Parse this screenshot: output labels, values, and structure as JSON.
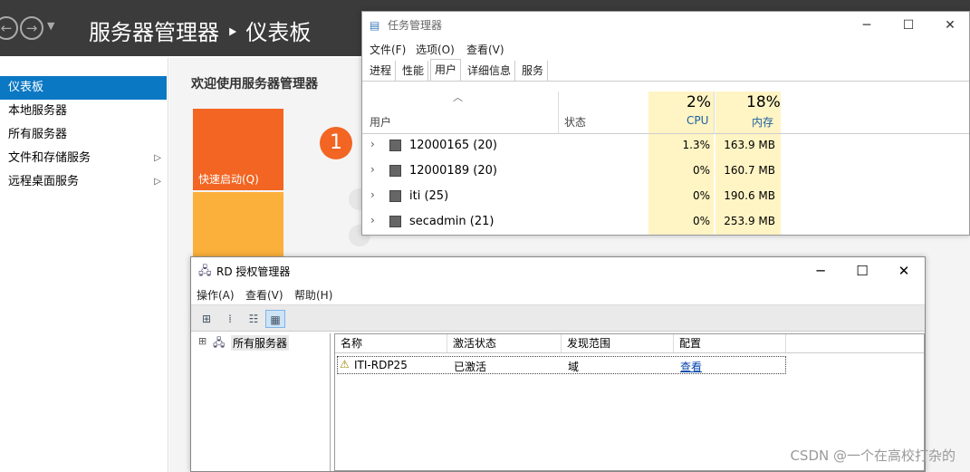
{
  "server_manager": {
    "breadcrumb_title": "服务器管理器 ‣ 仪表板",
    "sidebar": [
      "仪表板",
      "本地服务器",
      "所有服务器",
      "文件和存储服务",
      "远程桌面服务"
    ],
    "welcome": "欢迎使用服务器管理器",
    "quick_start": "快速启动(Q)",
    "step_badge": "1"
  },
  "task_manager": {
    "title": "任务管理器",
    "menu": [
      "文件(F)",
      "选项(O)",
      "查看(V)"
    ],
    "tabs": [
      "进程",
      "性能",
      "用户",
      "详细信息",
      "服务"
    ],
    "active_tab": "用户",
    "columns": {
      "user": "用户",
      "status": "状态",
      "cpu": "CPU",
      "mem": "内存"
    },
    "cpu_total": "2%",
    "mem_total": "18%",
    "rows": [
      {
        "name": "12000165 (20)",
        "cpu": "1.3%",
        "mem": "163.9 MB"
      },
      {
        "name": "12000189 (20)",
        "cpu": "0%",
        "mem": "160.7 MB"
      },
      {
        "name": "iti (25)",
        "cpu": "0%",
        "mem": "190.6 MB"
      },
      {
        "name": "secadmin (21)",
        "cpu": "0%",
        "mem": "253.9 MB"
      }
    ]
  },
  "rd_license": {
    "title": "RD 授权管理器",
    "menu": [
      "操作(A)",
      "查看(V)",
      "帮助(H)"
    ],
    "tree_root": "所有服务器",
    "columns": [
      "名称",
      "激活状态",
      "发现范围",
      "配置"
    ],
    "row": {
      "name": "ITI-RDP25",
      "status": "已激活",
      "scope": "域",
      "config": "查看"
    }
  },
  "watermark": "CSDN @一个在高校打杂的"
}
